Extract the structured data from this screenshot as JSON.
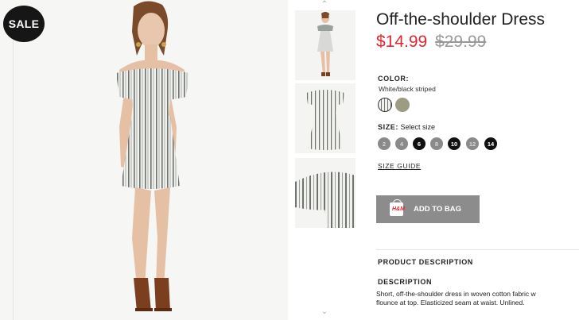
{
  "badge": {
    "sale_label": "SALE"
  },
  "product": {
    "title": "Off-the-shoulder Dress",
    "price_now": "$14.99",
    "price_was": "$29.99"
  },
  "color": {
    "label": "COLOR:",
    "value": "White/black striped",
    "swatches": [
      "#f2f2f0",
      "#9c9c82"
    ]
  },
  "size": {
    "label": "SIZE:",
    "prompt": "Select size",
    "options": [
      {
        "label": "2",
        "available": false
      },
      {
        "label": "4",
        "available": false
      },
      {
        "label": "6",
        "available": true
      },
      {
        "label": "8",
        "available": false
      },
      {
        "label": "10",
        "available": true
      },
      {
        "label": "12",
        "available": false
      },
      {
        "label": "14",
        "available": true
      }
    ],
    "guide_label": "SIZE GUIDE"
  },
  "cart": {
    "add_label": "ADD TO BAG",
    "brand_mark": "H&M"
  },
  "details": {
    "section_title": "PRODUCT DESCRIPTION",
    "description_label": "DESCRIPTION",
    "description_line1": "Short, off-the-shoulder dress in woven cotton fabric w",
    "description_line2": "flounce at top. Elasticized seam at waist. Unlined."
  },
  "thumbnails": {
    "up_icon": "chevron-up-icon",
    "down_icon": "chevron-down-icon"
  },
  "colors": {
    "sale_red": "#e0262f",
    "button_gray": "#8c8c8c"
  }
}
